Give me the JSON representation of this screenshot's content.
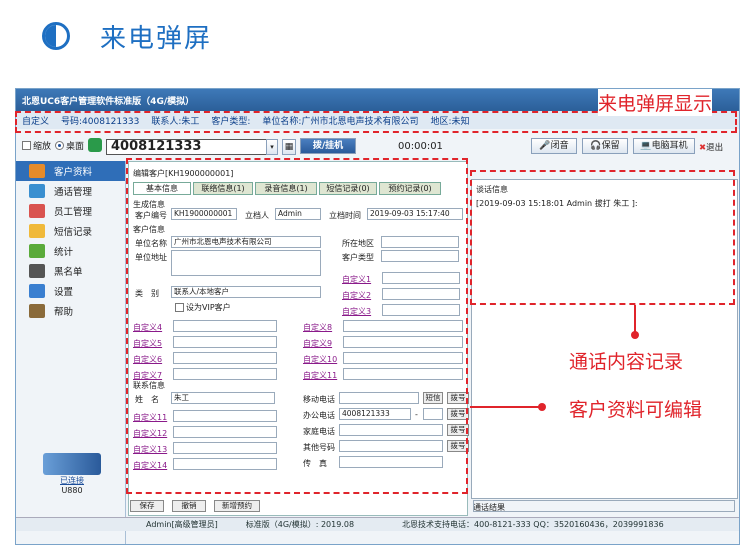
{
  "header": {
    "title": "来电弹屏"
  },
  "window": {
    "title": "北恩UC6客户管理软件标准版（4G/模拟）",
    "info": {
      "custom": "自定义",
      "number": "号码:4008121333",
      "contact": "联系人:朱工",
      "ctype": "客户类型:",
      "company": "单位名称:广州市北恩电声技术有限公司",
      "region": "地区:未知"
    },
    "callbar": {
      "opt_small": "缩放",
      "opt_desk": "桌面",
      "phone": "4008121333",
      "dial": "拨/挂机",
      "timer": "00:00:01",
      "btn_mute": "闭音",
      "btn_hold": "保留",
      "btn_headset": "电脑耳机",
      "btn_exit": "退出"
    },
    "sidebar": [
      {
        "label": "客户资料",
        "color": "#e58b2a"
      },
      {
        "label": "通话管理",
        "color": "#3a8fd0"
      },
      {
        "label": "员工管理",
        "color": "#d9534f"
      },
      {
        "label": "短信记录",
        "color": "#f0b93a"
      },
      {
        "label": "统计",
        "color": "#5aaa3a"
      },
      {
        "label": "黑名单",
        "color": "#555555"
      },
      {
        "label": "设置",
        "color": "#3a7fd0"
      },
      {
        "label": "帮助",
        "color": "#8a6a3a"
      }
    ],
    "device": {
      "status": "已连接",
      "model": "U880"
    },
    "panel": {
      "title": "编辑客户[KH1900000001]",
      "tabs": [
        "基本信息",
        "联络信息(1)",
        "录音信息(1)",
        "短信记录(0)",
        "预约记录(0)"
      ],
      "sec_gen": "生成信息",
      "lbl_custno": "客户编号",
      "custno": "KH1900000001",
      "lbl_owner": "立档人",
      "owner": "Admin",
      "lbl_ctime": "立档时间",
      "ctime": "2019-09-03 15:17:40",
      "sec_cust": "客户信息",
      "lbl_company": "单位名称",
      "company": "广州市北恩电声技术有限公司",
      "lbl_region": "所在地区",
      "lbl_addr": "单位地址",
      "lbl_ctype": "客户类型",
      "lbl_cat": "类　别",
      "cat": "联系人/本地客户",
      "vip": "设为VIP客户",
      "custom": [
        "自定义1",
        "自定义2",
        "自定义3",
        "自定义4",
        "自定义5",
        "自定义6",
        "自定义7",
        "自定义8",
        "自定义9",
        "自定义10",
        "自定义11",
        "自定义11",
        "自定义12",
        "自定义13",
        "自定义14"
      ],
      "sec_contact": "联系信息",
      "lbl_name": "姓　名",
      "name": "朱工",
      "lbl_mobile": "移动电话",
      "btn_sms": "短信",
      "btn_dial": "拨号",
      "lbl_office": "办公电话",
      "office": "4008121333",
      "dash": "-",
      "lbl_home": "家庭电话",
      "lbl_other": "其他号码",
      "lbl_fax": "传　真"
    },
    "right": {
      "title": "谈话信息",
      "log": "[2019-09-03 15:18:01 Admin 拔打 朱工 ]:",
      "result": "通话结果"
    },
    "bottom": {
      "save": "保存",
      "cancel": "撤销",
      "book": "新增预约"
    },
    "status": {
      "user": "Admin[高级管理员]",
      "ver": "标准版（4G/模拟）: 2019.08",
      "support": "北恩技术支持电话：400-8121-333  QQ：3520160436，2039991836"
    }
  },
  "annotations": {
    "popup": "来电弹屏显示",
    "record": "通话内容记录",
    "edit": "客户资料可编辑"
  },
  "colors": {
    "accent": "#1e6fc2",
    "annotation": "#e0242b"
  }
}
